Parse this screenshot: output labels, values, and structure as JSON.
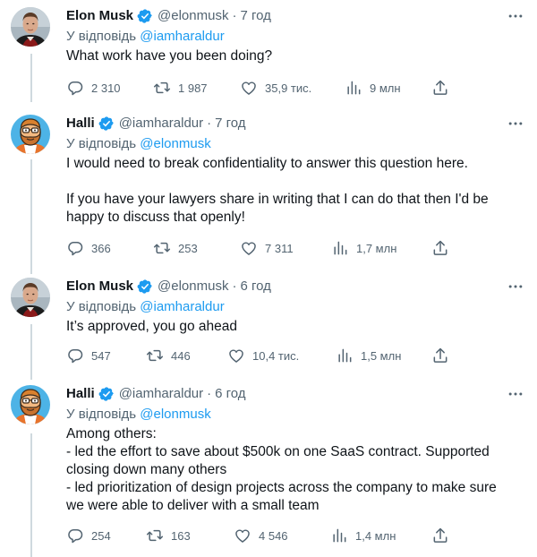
{
  "icons": {
    "reply": "reply-icon",
    "retweet": "retweet-icon",
    "like": "heart-icon",
    "views": "views-icon",
    "share": "share-icon",
    "more": "more-icon",
    "verified": "verified-badge-icon"
  },
  "colors": {
    "accent": "#1d9bf0",
    "text": "#0f1419",
    "muted": "#536471",
    "thread_line": "#cfd9de"
  },
  "reply_prefix": "У відповідь",
  "tweets": [
    {
      "name": "Elon Musk",
      "handle": "@elonmusk",
      "time": "7 год",
      "reply_to": "@iamharaldur",
      "lines": [
        "What work have you been doing?"
      ],
      "replies": "2 310",
      "retweets": "1 987",
      "likes": "35,9 тис.",
      "views": "9 млн"
    },
    {
      "name": "Halli",
      "handle": "@iamharaldur",
      "time": "7 год",
      "reply_to": "@elonmusk",
      "lines": [
        "I would need to break confidentiality to answer this question here.",
        "",
        "If you have your lawyers share in writing that I can do that then I'd be",
        "happy to discuss that openly!"
      ],
      "replies": "366",
      "retweets": "253",
      "likes": "7 311",
      "views": "1,7 млн"
    },
    {
      "name": "Elon Musk",
      "handle": "@elonmusk",
      "time": "6 год",
      "reply_to": "@iamharaldur",
      "lines": [
        "It’s approved, you go ahead"
      ],
      "replies": "547",
      "retweets": "446",
      "likes": "10,4 тис.",
      "views": "1,5 млн"
    },
    {
      "name": "Halli",
      "handle": "@iamharaldur",
      "time": "6 год",
      "reply_to": "@elonmusk",
      "lines": [
        "Among others:",
        "- led the effort to save about $500k on one SaaS contract. Supported",
        "closing down many others",
        "- led prioritization of design projects across the company to make sure",
        "we were able to deliver with a small team"
      ],
      "replies": "254",
      "retweets": "163",
      "likes": "4 546",
      "views": "1,4 млн"
    }
  ]
}
